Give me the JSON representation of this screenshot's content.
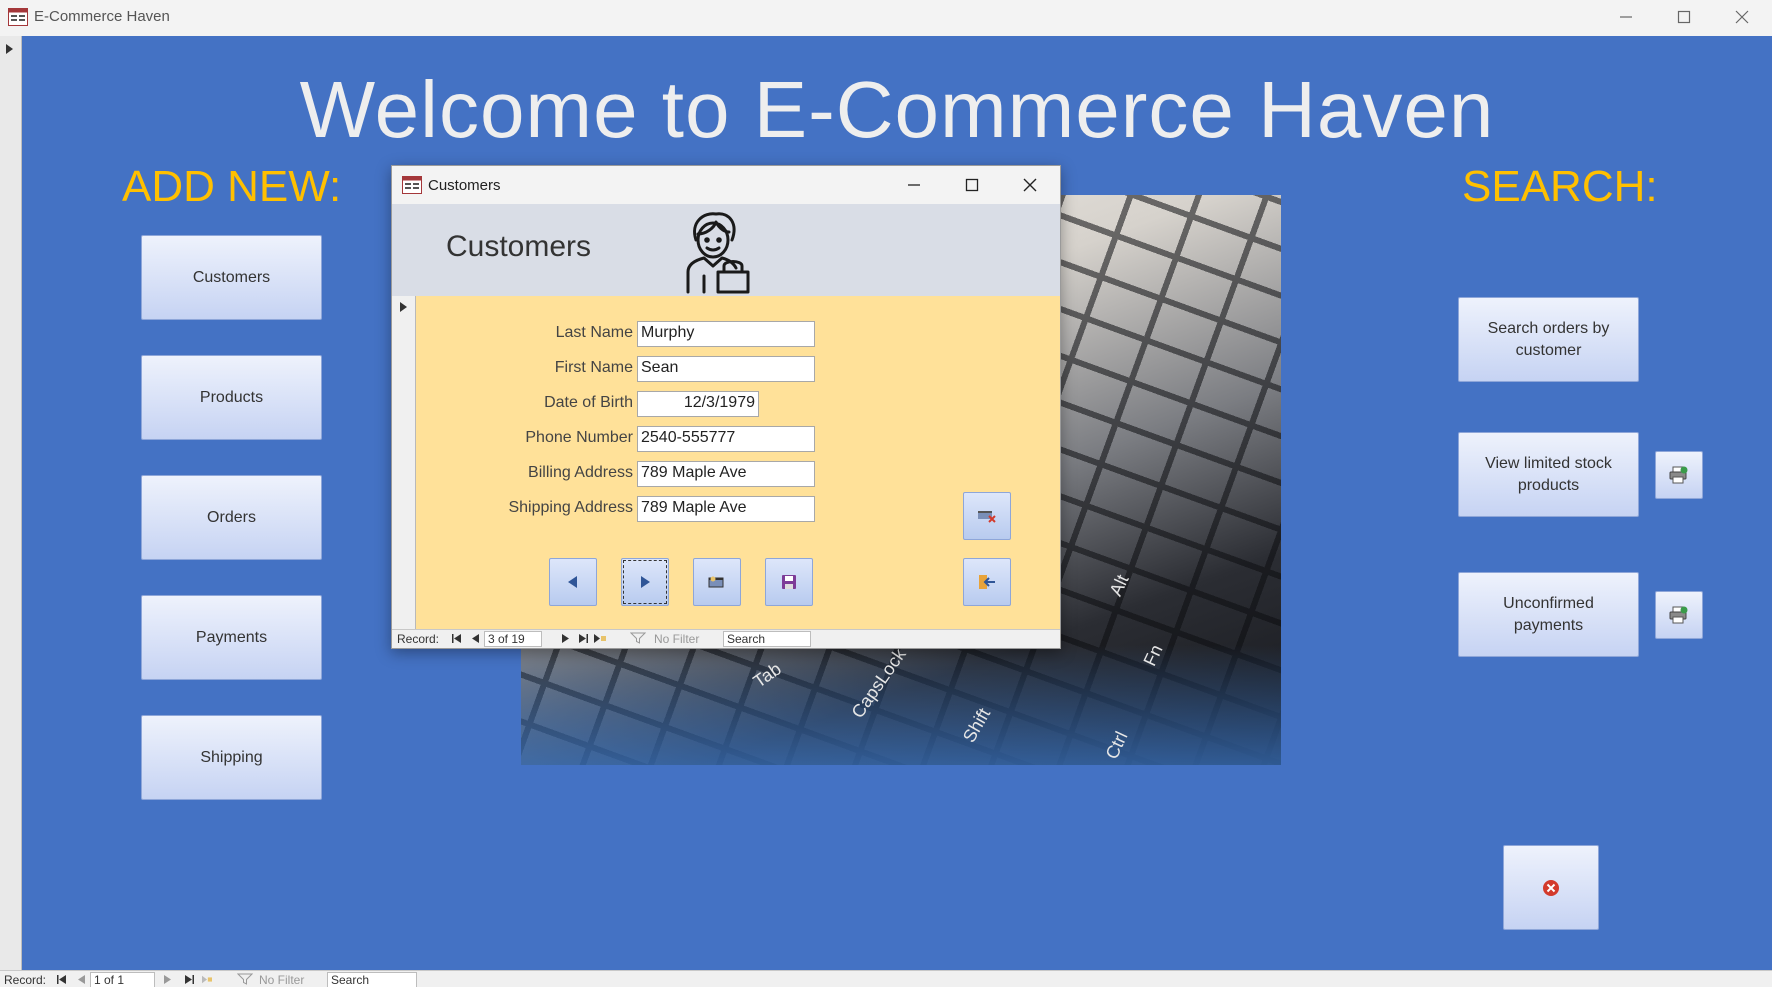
{
  "app": {
    "title": "E-Commerce Haven"
  },
  "main": {
    "welcome_title": "Welcome to E-Commerce Haven",
    "add_new_heading": "ADD NEW:",
    "search_heading": "SEARCH:",
    "add_buttons": [
      "Customers",
      "Products",
      "Orders",
      "Payments",
      "Shipping"
    ],
    "search_buttons": [
      "Search orders by customer",
      "View limited stock products",
      "Unconfirmed payments"
    ],
    "image_key_labels": [
      "Tab",
      "CapsLock",
      "Shift",
      "Ctrl",
      "Fn",
      "Alt"
    ]
  },
  "main_nav": {
    "record_label": "Record:",
    "record_value": "1 of 1",
    "filter_label": "No Filter",
    "search_placeholder": "Search"
  },
  "popup": {
    "window_title": "Customers",
    "form_title": "Customers",
    "fields": [
      {
        "label": "Last Name",
        "value": "Murphy"
      },
      {
        "label": "First Name",
        "value": "Sean"
      },
      {
        "label": "Date of Birth",
        "value": "12/3/1979"
      },
      {
        "label": "Phone Number",
        "value": "2540-555777"
      },
      {
        "label": "Billing Address",
        "value": "789 Maple Ave"
      },
      {
        "label": "Shipping Address",
        "value": "789 Maple Ave"
      }
    ],
    "nav": {
      "record_label": "Record:",
      "record_value": "3 of 19",
      "filter_label": "No Filter",
      "search_placeholder": "Search"
    }
  },
  "icons": {
    "app": "access-form-icon",
    "close_app": "red-x-circle-icon",
    "report": "report-print-icon",
    "customer": "shopper-with-bag-icon"
  },
  "colors": {
    "form_background": "#4472c4",
    "heading_accent": "#ffc000",
    "popup_body": "#ffe199",
    "popup_header": "#d9dde6"
  }
}
